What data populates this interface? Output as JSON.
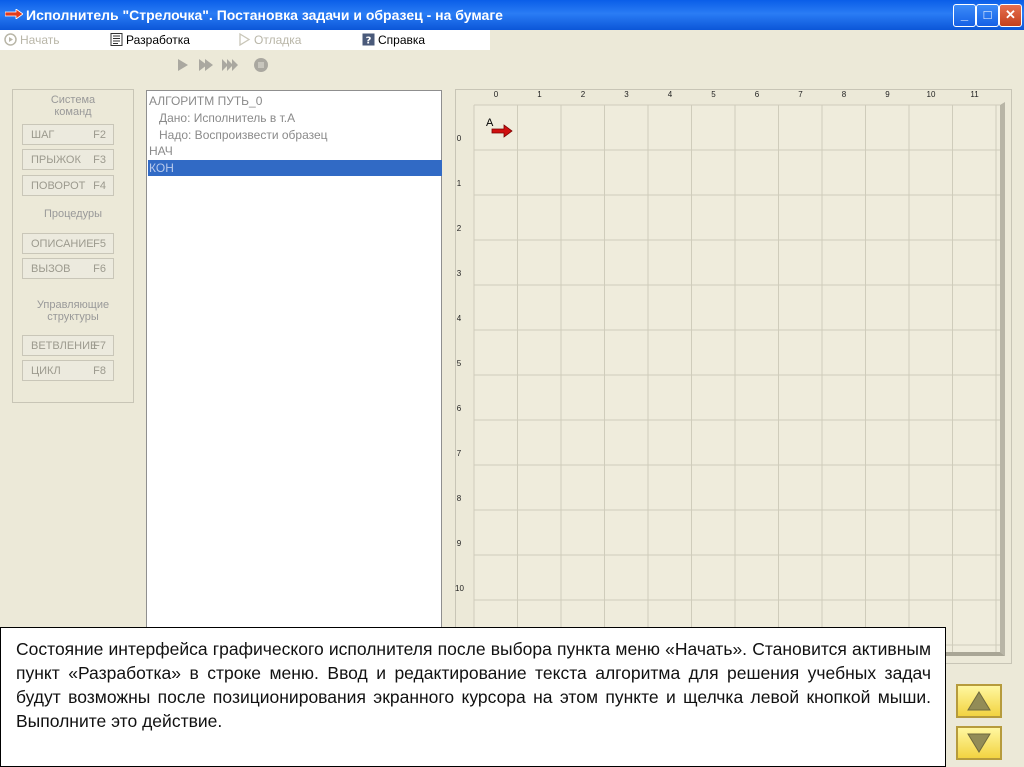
{
  "window": {
    "title": "Исполнитель \"Стрелочка\". Постановка задачи и образец - на бумаге"
  },
  "menu": [
    {
      "label": "Начать",
      "enabled": false
    },
    {
      "label": "Разработка",
      "enabled": true
    },
    {
      "label": "Отладка",
      "enabled": false
    },
    {
      "label": "Справка",
      "enabled": true
    }
  ],
  "command_panel": {
    "system_label": "Система\nкоманд",
    "commands": [
      {
        "label": "ШАГ",
        "key": "F2"
      },
      {
        "label": "ПРЫЖОК",
        "key": "F3"
      },
      {
        "label": "ПОВОРОТ",
        "key": "F4"
      }
    ],
    "procedures_label": "Процедуры",
    "procedures": [
      {
        "label": "ОПИСАНИЕ",
        "key": "F5"
      },
      {
        "label": "ВЫЗОВ",
        "key": "F6"
      }
    ],
    "control_label": "Управляющие\nструктуры",
    "controls": [
      {
        "label": "ВЕТВЛЕНИЕ",
        "key": "F7"
      },
      {
        "label": "ЦИКЛ",
        "key": "F8"
      }
    ]
  },
  "editor": {
    "lines": [
      "АЛГОРИТМ ПУТЬ_0",
      "   Дано: Исполнитель в т.А",
      "   Надо: Воспроизвести образец",
      "НАЧ",
      "КОН"
    ],
    "selected_line": 4
  },
  "field": {
    "columns": [
      "0",
      "1",
      "2",
      "3",
      "4",
      "5",
      "6",
      "7",
      "8",
      "9",
      "10",
      "11"
    ],
    "rows": [
      "0",
      "1",
      "2",
      "3",
      "4",
      "5",
      "6",
      "7",
      "8",
      "9",
      "10"
    ],
    "start_label": "А",
    "colors": {
      "grid": "#cfccbb",
      "cell": "#efecdc",
      "arrow": "#d01010"
    }
  },
  "caption": "Состояние интерфейса графического исполнителя после выбора пункта меню «Начать». Становится активным пункт «Разработка» в строке меню. Ввод и редактирование текста алгоритма для решения учебных задач будут возможны после позиционирования экранного курсора на этом пункте и щелчка левой кнопкой мыши. Выполните это действие."
}
